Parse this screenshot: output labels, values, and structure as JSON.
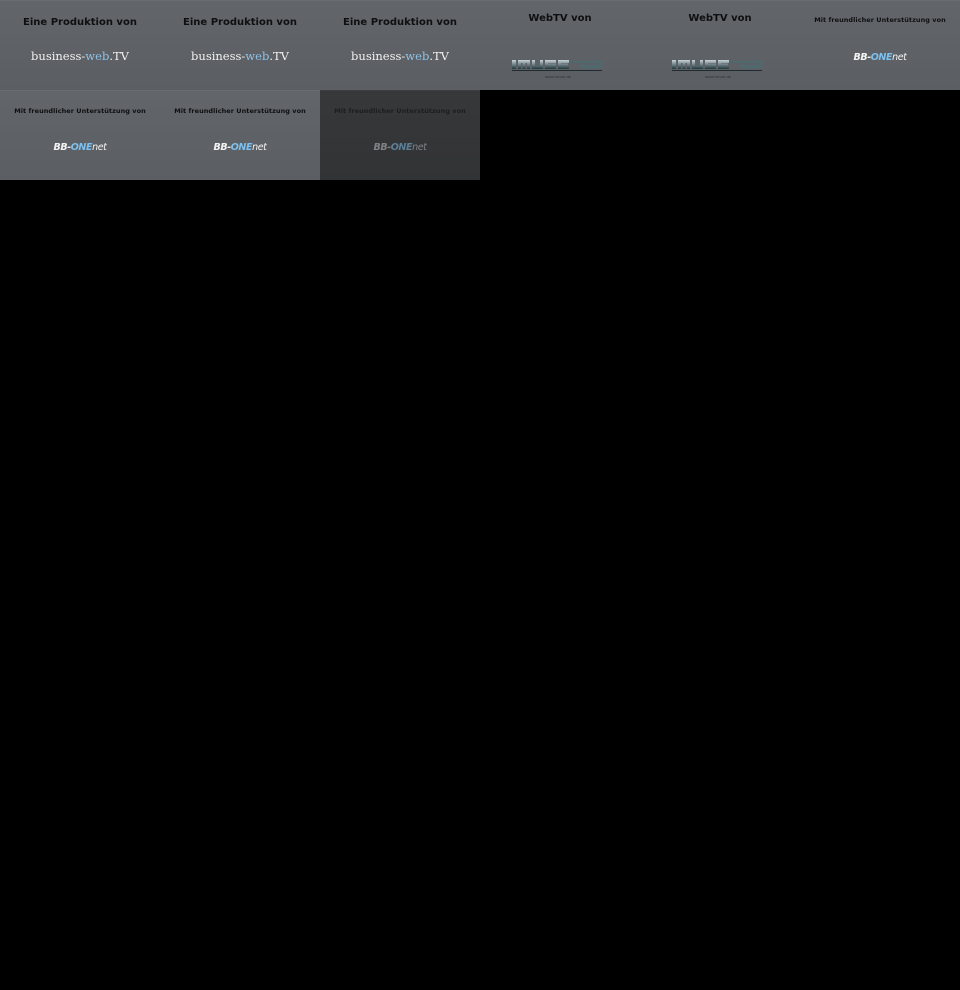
{
  "tiles": [
    {
      "heading": "Eine Produktion von",
      "logo": {
        "part1": "business-",
        "part2": "web",
        "part3": ".TV"
      }
    },
    {
      "heading": "Eine Produktion von",
      "logo": {
        "part1": "business-",
        "part2": "web",
        "part3": ".TV"
      }
    },
    {
      "heading": "Eine Produktion von",
      "logo": {
        "part1": "business-",
        "part2": "web",
        "part3": ".TV"
      }
    },
    {
      "heading": "WebTV von",
      "logo": {
        "text": "IMUSE",
        "sub": "www.imuse.de"
      }
    },
    {
      "heading": "WebTV von",
      "logo": {
        "text": "IMUSE",
        "sub": "www.imuse.de"
      }
    },
    {
      "heading": "Mit freundlicher Unterstützung von",
      "logo": {
        "part1": "BB-",
        "part2": "ONE",
        "part3": "net"
      }
    },
    {
      "heading": "Mit freundlicher Unterstützung von",
      "logo": {
        "part1": "BB-",
        "part2": "ONE",
        "part3": "net"
      }
    },
    {
      "heading": "Mit freundlicher Unterstützung von",
      "logo": {
        "part1": "BB-",
        "part2": "ONE",
        "part3": "net"
      }
    },
    {
      "heading": "Mit freundlicher Unterstützung von",
      "logo": {
        "part1": "BB-",
        "part2": "ONE",
        "part3": "net"
      }
    }
  ],
  "colors": {
    "page_background": "#000000",
    "tile_background": "#5e6267",
    "tile_dimmed_background": "#343537",
    "logo_accent_blue": "#8fc3e8"
  }
}
